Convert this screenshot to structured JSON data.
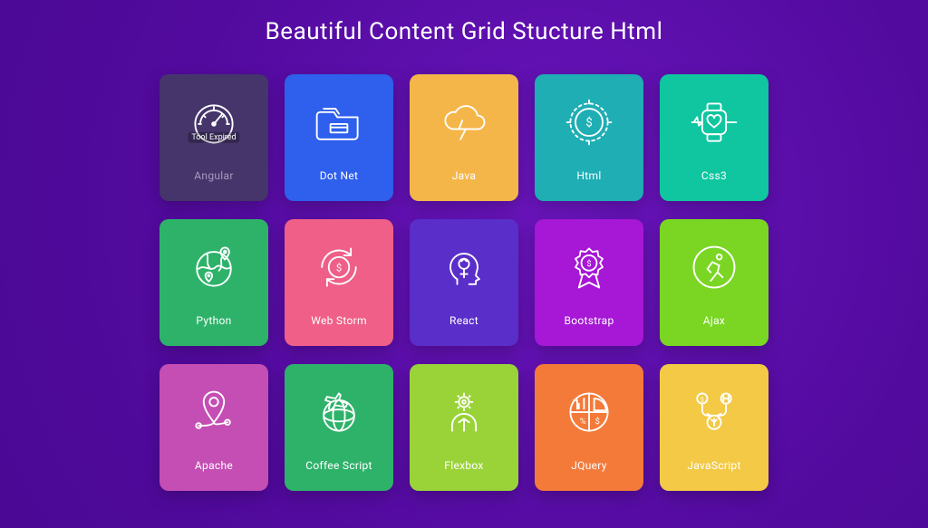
{
  "title": "Beautiful Content Grid Stucture Html",
  "cards": [
    {
      "label": "Angular",
      "icon": "gauge-icon",
      "overlay": "Tool Expired"
    },
    {
      "label": "Dot Net",
      "icon": "folder-icon"
    },
    {
      "label": "Java",
      "icon": "cloud-bolt-icon"
    },
    {
      "label": "Html",
      "icon": "globe-dollar-icon"
    },
    {
      "label": "Css3",
      "icon": "heart-watch-icon"
    },
    {
      "label": "Python",
      "icon": "earth-pin-icon"
    },
    {
      "label": "Web Storm",
      "icon": "refresh-dollar-icon"
    },
    {
      "label": "React",
      "icon": "head-idea-icon"
    },
    {
      "label": "Bootstrap",
      "icon": "award-dollar-icon"
    },
    {
      "label": "Ajax",
      "icon": "runner-icon"
    },
    {
      "label": "Apache",
      "icon": "map-pin-icon"
    },
    {
      "label": "Coffee Script",
      "icon": "globe-plane-icon"
    },
    {
      "label": "Flexbox",
      "icon": "user-gear-icon"
    },
    {
      "label": "JQuery",
      "icon": "chart-pie-icon"
    },
    {
      "label": "JavaScript",
      "icon": "flow-coins-icon"
    }
  ]
}
